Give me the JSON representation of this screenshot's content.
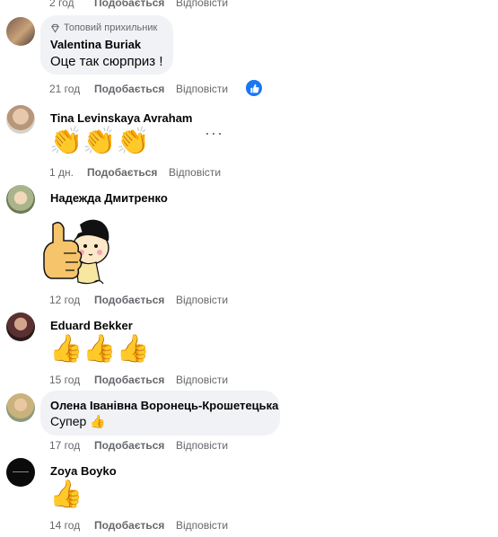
{
  "top_row": {
    "time": "2 год",
    "like": "Подобається",
    "reply": "Відповісти"
  },
  "comments": [
    {
      "author": "Valentina Buriak",
      "badge": "Топовий прихильник",
      "text": "Оце так сюрприз !",
      "time": "21 год",
      "like": "Подобається",
      "reply": "Відповісти",
      "reactions": "like"
    },
    {
      "author": "Tina Levinskaya Avraham",
      "text": "👏👏👏",
      "time": "1 дн.",
      "like": "Подобається",
      "reply": "Відповісти",
      "more": "···"
    },
    {
      "author": "Надежда Дмитренко",
      "sticker": "thumbs-up-girl",
      "time": "12 год",
      "like": "Подобається",
      "reply": "Відповісти"
    },
    {
      "author": "Eduard Bekker",
      "text": "👍👍👍",
      "time": "15 год",
      "like": "Подобається",
      "reply": "Відповісти"
    },
    {
      "author": "Олена Іванівна Воронець-Крошетецька",
      "text": "Супер 👍",
      "time": "17 год",
      "like": "Подобається",
      "reply": "Відповісти"
    },
    {
      "author": "Zoya Boyko",
      "text": "👍",
      "time": "14 год",
      "like": "Подобається",
      "reply": "Відповісти"
    }
  ],
  "colors": {
    "bubble": "#f0f2f5",
    "meta": "#65676b",
    "like_blue": "#1877f2"
  }
}
